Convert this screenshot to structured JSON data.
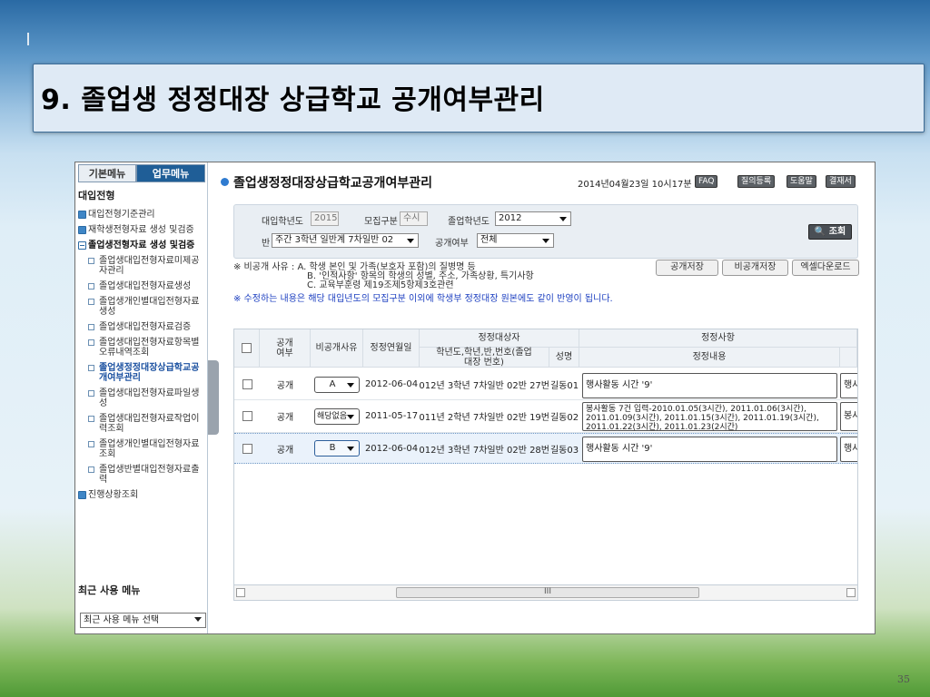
{
  "slide": {
    "title": "9. 졸업생 정정대장 상급학교 공개여부관리",
    "page_number": "35"
  },
  "left_panel": {
    "tabs": [
      "기본메뉴",
      "업무메뉴"
    ],
    "section": "대입전형",
    "items": [
      {
        "label": "대입전형기준관리",
        "type": "plus"
      },
      {
        "label": "재학생전형자료 생성 및검증",
        "type": "plus"
      },
      {
        "label": "졸업생전형자료 생성 및검증",
        "type": "minus"
      },
      {
        "label": "졸업생대입전형자료미제공자관리",
        "type": "sub"
      },
      {
        "label": "졸업생대입전형자료생성",
        "type": "sub"
      },
      {
        "label": "졸업생개인별대입전형자료생성",
        "type": "sub"
      },
      {
        "label": "졸업생대입전형자료검증",
        "type": "sub"
      },
      {
        "label": "졸업생대입전형자료항목별오류내역조회",
        "type": "sub"
      },
      {
        "label": "졸업생정정대장상급학교공개여부관리",
        "type": "sub-active"
      },
      {
        "label": "졸업생대입전형자료파일생성",
        "type": "sub"
      },
      {
        "label": "졸업생대입전형자료작업이력조회",
        "type": "sub"
      },
      {
        "label": "졸업생개인별대입전형자료조회",
        "type": "sub"
      },
      {
        "label": "졸업생반별대입전형자료출력",
        "type": "sub"
      },
      {
        "label": "진행상황조회",
        "type": "plus"
      }
    ],
    "recent_menu_title": "최근 사용 메뉴",
    "recent_menu_select": "최근 사용 메뉴 선택"
  },
  "main": {
    "title": "졸업생정정대장상급학교공개여부관리",
    "datetime": "2014년04월23일 10시17분",
    "toolbar": [
      "FAQ",
      "질의등록",
      "도움말",
      "결재서"
    ],
    "search": {
      "admission_year_label": "대입학년도",
      "admission_year_value": "2015",
      "recruit_type_label": "모집구분",
      "recruit_type_value": "수시",
      "grad_year_label": "졸업학년도",
      "grad_year_value": "2012",
      "class_label": "반",
      "class_value": "주간 3학년 일반계 7차일반 02",
      "public_label": "공개여부",
      "public_value": "전체",
      "search_button": "조회"
    },
    "notes": {
      "reason_line1": "※ 비공개 사유 : A. 학생 본인 및 가족(보호자 포함)의 질병명 등",
      "reason_line2": "B. '인적사항' 항목의 학생의 성별, 주소, 가족상황, 특기사항",
      "reason_line3": "C. 교육부훈령 제19조제5항제3호관련",
      "warning": "※ 수정하는 내용은 해당 대입년도의 모집구분 이외에 학생부 정정대장 원본에도 같이 반영이 됩니다."
    },
    "actions": [
      "공개저장",
      "비공개저장",
      "엑셀다운로드"
    ],
    "table": {
      "headers": {
        "public": "공개여부",
        "reason": "비공개사유",
        "date": "정정연월일",
        "target": "정정대상자",
        "grade_class": "학년도,학년,반,번호(졸업대장 번호)",
        "name": "성명",
        "item": "정정사항",
        "content": "정정내용"
      },
      "rows": [
        {
          "public": "공개",
          "reason": "A",
          "date": "2012-06-04",
          "grade_class": "012년 3학년 7차일반 02반 27번",
          "name": "길동01",
          "content": "행사활동 시간 '9'",
          "extra": "행사"
        },
        {
          "public": "공개",
          "reason": "해당없음",
          "date": "2011-05-17",
          "grade_class": "011년 2학년 7차일반 02반 19번",
          "name": "길동02",
          "content": "봉사활동 7건 입력-2010.01.05(3시간), 2011.01.06(3시간), 2011.01.09(3시간), 2011.01.15(3시간), 2011.01.19(3시간), 2011.01.22(3시간), 2011.01.23(2시간)",
          "extra": "봉사"
        },
        {
          "public": "공개",
          "reason": "B",
          "date": "2012-06-04",
          "grade_class": "012년 3학년 7차일반 02반 28번",
          "name": "길동03",
          "content": "행사활동 시간 '9'",
          "extra": "행사"
        }
      ]
    },
    "scrollbar_label": "III"
  }
}
